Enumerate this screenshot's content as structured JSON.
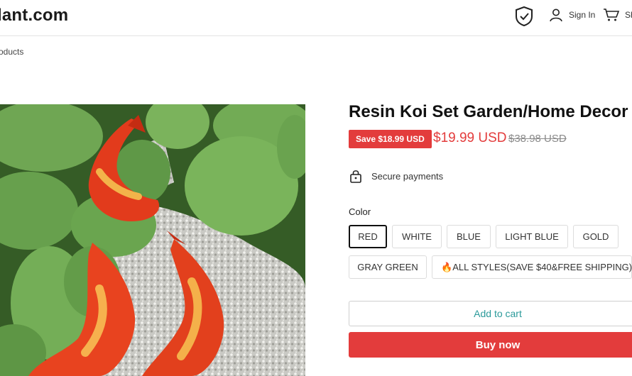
{
  "header": {
    "logo_text": "lant.com",
    "signin_label": "Sign In",
    "cart_label": "Sh"
  },
  "breadcrumb": "roducts",
  "product": {
    "title": "Resin Koi Set Garden/Home Decor",
    "save_badge": "Save $18.99 USD",
    "price": "$19.99 USD",
    "compare_price": "$38.98 USD",
    "secure_text": "Secure payments",
    "color_label": "Color",
    "selected_color": "RED",
    "colors": [
      "RED",
      "WHITE",
      "BLUE",
      "LIGHT BLUE",
      "GOLD",
      "GRAY GREEN",
      "ALL STYLES(SAVE $40&FREE SHIPPING)"
    ],
    "fire_emoji": "🔥"
  },
  "buttons": {
    "add_to_cart": "Add to cart",
    "buy_now": "Buy now"
  },
  "icons": {
    "shield": "shield-check-icon",
    "user": "user-icon",
    "cart": "cart-icon",
    "lock": "lock-icon"
  },
  "colors": {
    "accent_red": "#e33c3c",
    "add_to_cart_text": "#2b9a9a"
  }
}
